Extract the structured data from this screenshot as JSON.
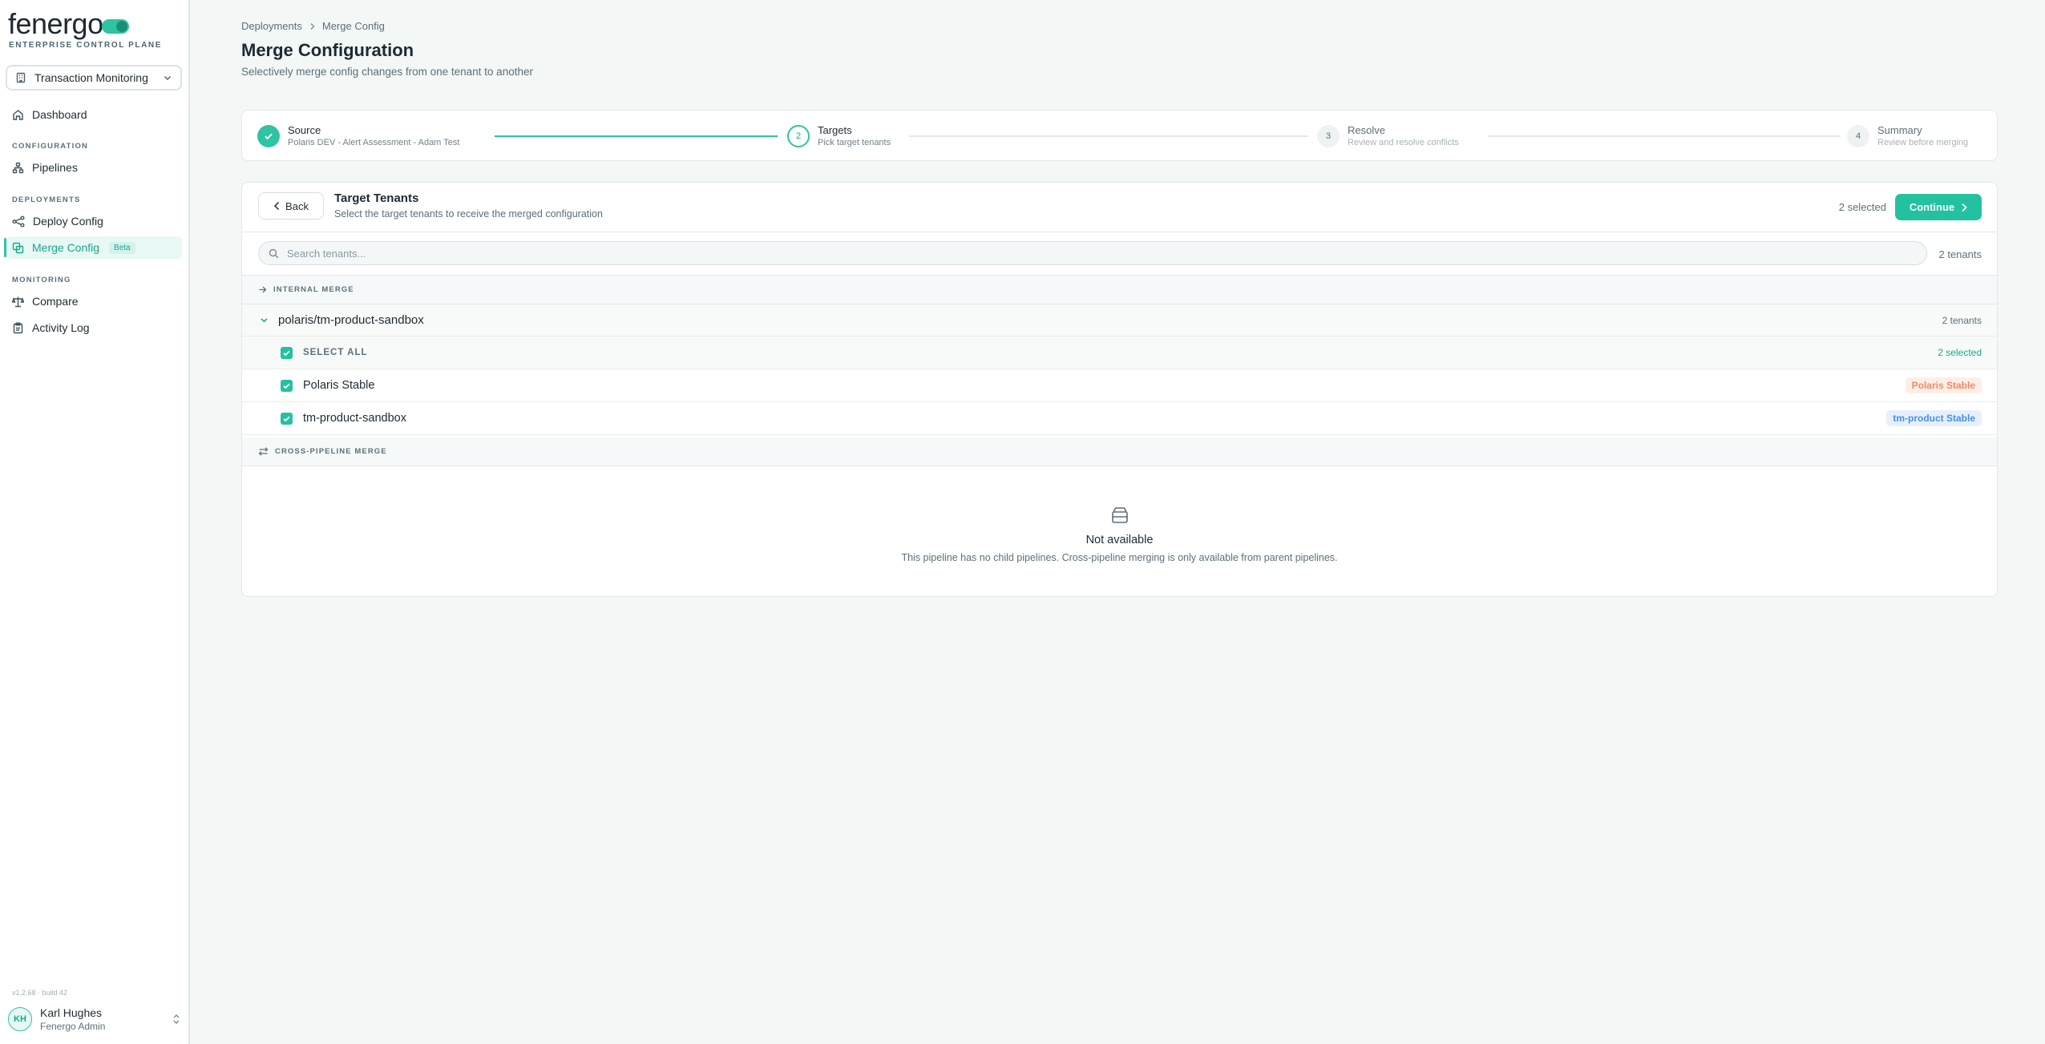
{
  "brand": {
    "logo_text": "fenergo",
    "subtitle": "ENTERPRISE CONTROL PLANE"
  },
  "pipeline_selector": {
    "value": "Transaction Monitoring"
  },
  "sidebar": {
    "dashboard": "Dashboard",
    "sections": {
      "configuration": "CONFIGURATION",
      "deployments": "DEPLOYMENTS",
      "monitoring": "MONITORING"
    },
    "items": {
      "pipelines": "Pipelines",
      "deploy_config": "Deploy Config",
      "merge_config": "Merge Config",
      "merge_badge": "Beta",
      "compare": "Compare",
      "activity_log": "Activity Log"
    },
    "version": "v1.2.68 · build 42"
  },
  "user": {
    "initials": "KH",
    "name": "Karl Hughes",
    "role": "Fenergo Admin"
  },
  "breadcrumb": {
    "parent": "Deployments",
    "current": "Merge Config"
  },
  "page": {
    "title": "Merge Configuration",
    "subtitle": "Selectively merge config changes from one tenant to another"
  },
  "stepper": {
    "steps": [
      {
        "number": "1",
        "title": "Source",
        "desc": "Polaris DEV - Alert Assessment - Adam Test",
        "state": "done"
      },
      {
        "number": "2",
        "title": "Targets",
        "desc": "Pick target tenants",
        "state": "current"
      },
      {
        "number": "3",
        "title": "Resolve",
        "desc": "Review and resolve conflicts",
        "state": "pending"
      },
      {
        "number": "4",
        "title": "Summary",
        "desc": "Review before merging",
        "state": "pending"
      }
    ]
  },
  "targets": {
    "back_label": "Back",
    "title": "Target Tenants",
    "subtitle": "Select the target tenants to receive the merged configuration",
    "selected_count": "2 selected",
    "continue_label": "Continue",
    "search_placeholder": "Search tenants...",
    "tenant_count": "2 tenants",
    "internal_label": "INTERNAL MERGE",
    "group": {
      "name": "polaris/tm-product-sandbox",
      "count": "2 tenants",
      "select_all_label": "SELECT ALL",
      "select_all_count": "2 selected",
      "tenants": [
        {
          "name": "Polaris Stable",
          "badge": "Polaris Stable",
          "badge_color": "#f08c63"
        },
        {
          "name": "tm-product-sandbox",
          "badge": "tm-product Stable",
          "badge_color": "#4a8fe0"
        }
      ]
    },
    "cross_label": "CROSS-PIPELINE MERGE",
    "empty": {
      "title": "Not available",
      "desc": "This pipeline has no child pipelines. Cross-pipeline merging is only available from parent pipelines."
    }
  },
  "colors": {
    "accent": "#24c1a0",
    "accent_dark": "#17a88a",
    "background": "#f3f7f6"
  }
}
